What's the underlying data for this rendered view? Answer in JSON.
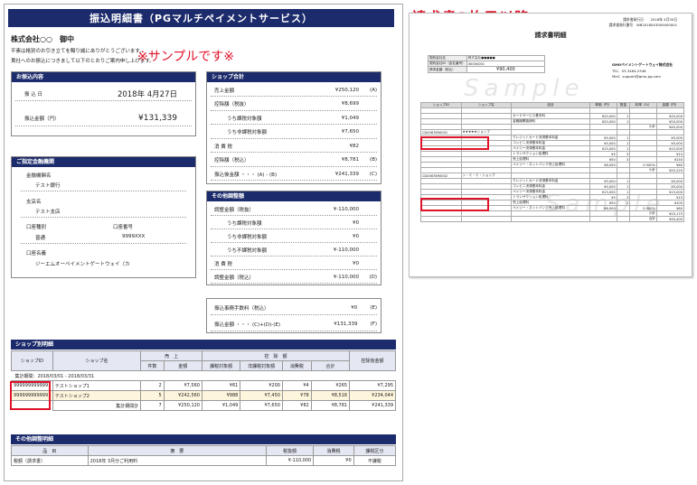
{
  "doc": {
    "title": "振込明細書（PGマルチペイメントサービス）",
    "company": "株式会社○○　御中",
    "greeting1": "平素は格別のお引き立てを賜り誠にありがとうございます。",
    "greeting2": "貴社へのお振込につきまして以下のとおりご案内申し上げます。",
    "sample_note": "※サンプルです※",
    "page2_note": "請求書2枚目以降"
  },
  "furikomi": {
    "header": "お振込内容",
    "date_label": "振 込 日",
    "date_value": "2018年 4月27日",
    "amount_label": "振込金額（円）",
    "amount_value": "¥131,339"
  },
  "bank": {
    "header": "ご指定金融機関",
    "inst_label": "金融機関名",
    "inst_value": "テスト銀行",
    "branch_label": "支店名",
    "branch_value": "テスト支店",
    "type_label": "口座種別",
    "type_value": "普通",
    "num_label": "口座番号",
    "num_value": "9999XXX",
    "holder_label": "口座名義",
    "holder_value": "ジーエムオーペイメントゲートウェイ（カ"
  },
  "shop_total": {
    "header": "ショップ合計",
    "rows": [
      {
        "label": "売上金額",
        "value": "¥250,120",
        "mark": "(A)"
      },
      {
        "label": "控除額（税抜）",
        "value": "¥8,699",
        "mark": ""
      },
      {
        "label": "うち課税対象額",
        "value": "¥1,049",
        "mark": ""
      },
      {
        "label": "うち非課税対象額",
        "value": "¥7,650",
        "mark": ""
      },
      {
        "label": "消 費 税",
        "value": "¥82",
        "mark": ""
      },
      {
        "label": "控除額（税込）",
        "value": "¥8,781",
        "mark": "(B)"
      },
      {
        "label": "振込後金額 ・・・ (A) - (B)",
        "value": "¥241,339",
        "mark": "(C)"
      }
    ]
  },
  "other": {
    "header": "その他調整額",
    "rows": [
      {
        "label": "調整金額（税抜）",
        "value": "¥-110,000",
        "mark": ""
      },
      {
        "label": "うち課税対象額",
        "value": "¥0",
        "mark": ""
      },
      {
        "label": "うち非課税対象額",
        "value": "¥0",
        "mark": ""
      },
      {
        "label": "うち不課税対象額",
        "value": "¥-110,000",
        "mark": ""
      },
      {
        "label": "消 費 税",
        "value": "¥0",
        "mark": ""
      },
      {
        "label": "調整金額（税込）",
        "value": "¥-110,000",
        "mark": "(D)"
      }
    ]
  },
  "fee": {
    "label": "振込事務手数料（税込）",
    "value": "¥0",
    "mark": "(E)",
    "after_label": "振込金額 ・・・ (C)+(D)-(E)",
    "after_value": "¥131,339",
    "after_mark": "(F)"
  },
  "shop_detail": {
    "header": "ショップ別明細",
    "col_shopid": "ショップID",
    "col_shopname": "ショップ名",
    "col_sales": "売　上",
    "col_count": "件数",
    "col_amount": "金額",
    "col_kojo": "控　除　額",
    "col_tax": "課税対象額",
    "col_nontax": "非課税対象額",
    "col_ctax": "消費税",
    "col_sum": "合計",
    "col_after": "控除後金額",
    "period": "集計期間：2018/03/01 - 2018/03/31",
    "rows": [
      {
        "id": "999999999999",
        "name": "テストショップ1",
        "count": "2",
        "amount": "¥7,560",
        "tax": "¥61",
        "nontax": "¥200",
        "ctax": "¥4",
        "sum": "¥265",
        "after": "¥7,295"
      },
      {
        "id": "999999999999",
        "name": "テストショップ2",
        "count": "5",
        "amount": "¥242,560",
        "tax": "¥988",
        "nontax": "¥7,450",
        "ctax": "¥78",
        "sum": "¥8,516",
        "after": "¥234,044"
      }
    ],
    "total": {
      "label": "集計期間計",
      "count": "7",
      "amount": "¥250,120",
      "tax": "¥1,049",
      "nontax": "¥7,650",
      "ctax": "¥82",
      "sum": "¥8,781",
      "after": "¥241,339"
    }
  },
  "other_detail": {
    "header": "その他調整明細",
    "col_item": "品　目",
    "col_desc": "摘　要",
    "col_amount": "税抜額",
    "col_ctax": "消費税",
    "col_kubun": "課税区分",
    "rows": [
      {
        "item": "税額（請求書）",
        "desc": "2018年 3月分ご利用料",
        "amount": "¥-110,000",
        "ctax": "¥0",
        "kubun": "不課税"
      }
    ]
  },
  "page2": {
    "title": "請求書明細",
    "meta1": "請求書発行日　　2018年 4月30日",
    "meta2": "請求書発行番号　WB2018043000000001",
    "cust_label": "契約会社名",
    "cust_value": "株式会社●●●●●",
    "id_label": "契約会社ID（会社番号）",
    "id_value": "00000001",
    "amount_label": "請求金額（税込）",
    "amount_value": "¥90,400",
    "issuer1": "GMOペイメントゲートウェイ株式会社",
    "issuer2": "TEL：03-3464-2346",
    "issuer3": "Mail：support@gmo-pg.com",
    "watermark": "Sample",
    "columns": [
      "ショップID",
      "ショップ名",
      "品目",
      "単価（円）",
      "数量",
      "料率（%）",
      "金額（円）"
    ],
    "section1": [
      {
        "c3": "カードサービス基本料",
        "c4": "¥20,000",
        "c5": "1",
        "c6": "",
        "c7": "¥20,000"
      },
      {
        "c3": "金融機関接続料",
        "c4": "¥20,000",
        "c5": "1",
        "c6": "",
        "c7": "¥20,000"
      },
      {
        "c3": "",
        "c4": "",
        "c5": "",
        "c6": "小計",
        "c7": "¥40,000"
      }
    ],
    "shop1_id": "CD4567890001",
    "shop1_name": "★★★★★ショップ",
    "section2": [
      {
        "c3": "クレジットカード決済基本料金",
        "c4": "¥5,000",
        "c5": "1",
        "c6": "",
        "c7": "¥5,000"
      },
      {
        "c3": "コンビニ決済基本料金",
        "c4": "¥5,000",
        "c5": "1",
        "c6": "",
        "c7": "¥5,000"
      },
      {
        "c3": "ペイジー決済基本料金",
        "c4": "¥15,000",
        "c5": "1",
        "c6": "",
        "c7": "¥15,000"
      },
      {
        "c3": "トランザクション処理料",
        "c4": "¥5",
        "c5": "3",
        "c6": "",
        "c7": "¥15"
      },
      {
        "c3": "売上処理料",
        "c4": "¥50",
        "c5": "3",
        "c6": "",
        "c7": "¥150"
      },
      {
        "c3": "ペイジー・ネットバンク売上処理料",
        "c4": "¥6,000",
        "c5": "",
        "c6": "0.500%",
        "c7": "¥60"
      },
      {
        "c3": "",
        "c4": "",
        "c5": "",
        "c6": "小計",
        "c7": "¥25,225"
      }
    ],
    "shop2_id": "CD4567890002",
    "shop2_name": "シ・ミ・ミ・ショップ",
    "section3": [
      {
        "c3": "クレジットカード決済基本料金",
        "c4": "¥5,000",
        "c5": "1",
        "c6": "",
        "c7": "¥5,000"
      },
      {
        "c3": "コンビニ決済基本料金",
        "c4": "¥5,000",
        "c5": "1",
        "c6": "",
        "c7": "¥5,000"
      },
      {
        "c3": "ペイジー決済基本料金",
        "c4": "¥15,000",
        "c5": "1",
        "c6": "",
        "c7": "¥15,000"
      },
      {
        "c3": "トランザクション処理料",
        "c4": "¥5",
        "c5": "3",
        "c6": "",
        "c7": "¥15"
      },
      {
        "c3": "売上処理料",
        "c4": "¥50",
        "c5": "2",
        "c6": "",
        "c7": "¥100"
      },
      {
        "c3": "ペイジー・ネットバンク売上処理料",
        "c4": "¥6,000",
        "c5": "",
        "c6": "0.500%",
        "c7": "¥60"
      },
      {
        "c3": "",
        "c4": "",
        "c5": "",
        "c6": "小計",
        "c7": "¥25,175"
      }
    ],
    "grand_label": "合計",
    "grand_value": "¥90,400"
  },
  "colors": {
    "navy": "#1c2b6b",
    "red": "#e0132a"
  }
}
